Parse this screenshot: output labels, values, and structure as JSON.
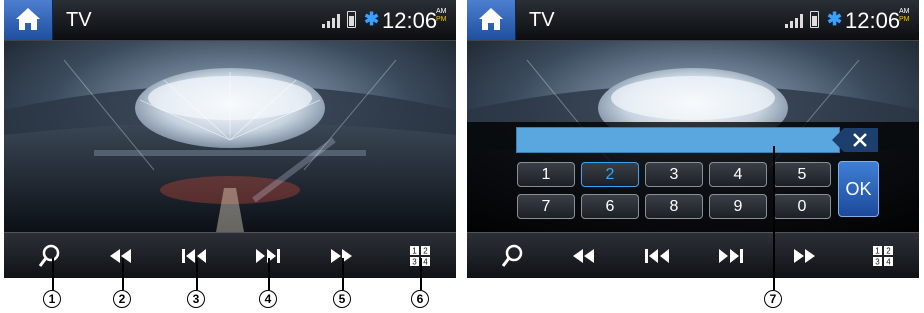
{
  "screens": [
    {
      "title": "TV",
      "clock": "12:06",
      "am": "AM",
      "pm": "PM"
    },
    {
      "title": "TV",
      "clock": "12:06",
      "am": "AM",
      "pm": "PM"
    }
  ],
  "controls": [
    "search-icon",
    "rewind-icon",
    "previous-track-icon",
    "next-track-icon",
    "fast-forward-icon",
    "keypad-icon"
  ],
  "callouts": [
    "1",
    "2",
    "3",
    "4",
    "5",
    "6",
    "7"
  ],
  "keypad": {
    "entry_value": "",
    "keys_row1": [
      "1",
      "2",
      "3",
      "4",
      "5"
    ],
    "keys_row2": [
      "7",
      "6",
      "8",
      "9",
      "0"
    ],
    "selected_key": "2",
    "ok_label": "OK"
  },
  "colors": {
    "statusbar": "#1a1d22",
    "home": "#2f63b8",
    "entry": "#5aa6de",
    "selected_key": "#3ba4f0",
    "ok": "#2b5fbf",
    "bluetooth": "#3aa0ff",
    "pm": "#f2c200"
  }
}
